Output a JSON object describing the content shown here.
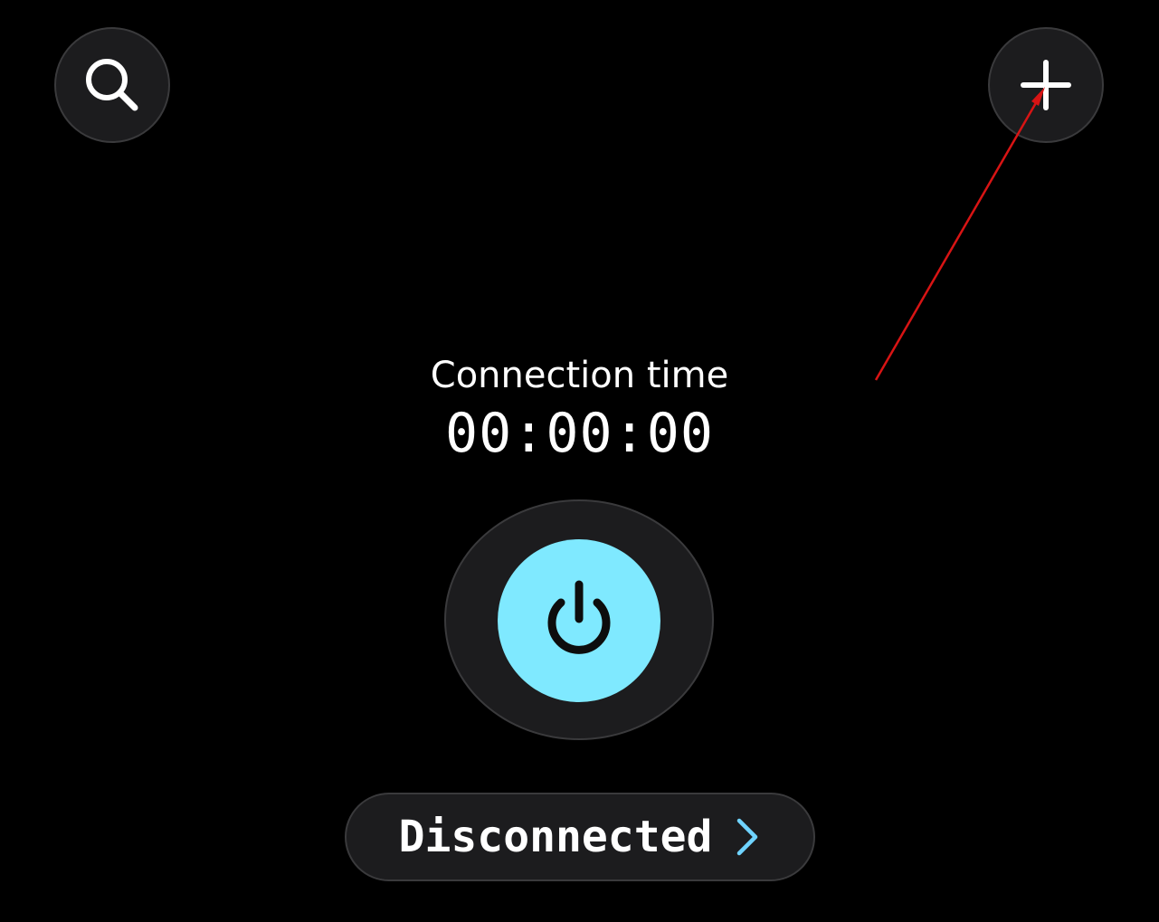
{
  "colors": {
    "background": "#000000",
    "button_surface": "#1c1c1e",
    "button_border": "#3a3a3c",
    "power_accent": "#7fe9ff",
    "chevron_accent": "#6fd3ff",
    "annotation_arrow": "#d81414"
  },
  "toolbar": {
    "search_icon": "search-icon",
    "add_icon": "plus-icon"
  },
  "connection": {
    "label": "Connection time",
    "timer": "00:00:00"
  },
  "power": {
    "icon": "power-icon"
  },
  "status": {
    "label": "Disconnected",
    "icon": "chevron-right-icon"
  }
}
